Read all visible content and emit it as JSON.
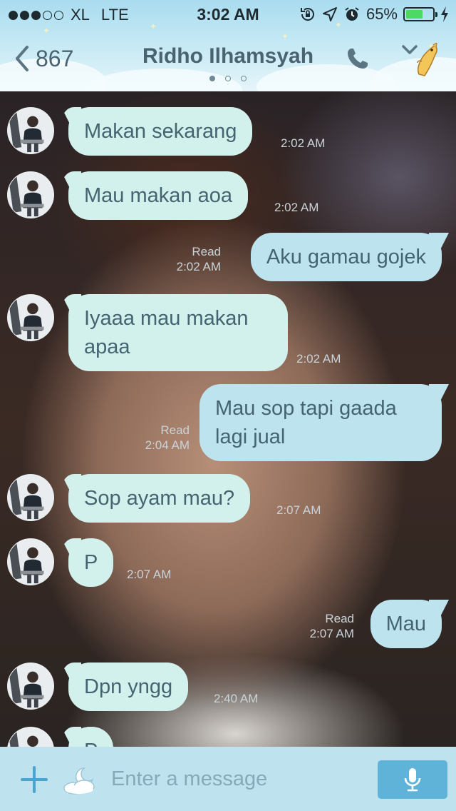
{
  "status_bar": {
    "carrier": "XL",
    "network": "LTE",
    "time": "3:02 AM",
    "battery": "65%",
    "battery_level": 0.65,
    "signal_bars_filled": 3,
    "signal_bars_total": 5
  },
  "nav": {
    "back_count": "867",
    "title": "Ridho Ilhamsyah",
    "page_count": 3,
    "active_page": 1
  },
  "messages": [
    {
      "direction": "in",
      "text": "Makan sekarang",
      "time": "2:02 AM"
    },
    {
      "direction": "in",
      "text": "Mau makan aoa",
      "time": "2:02 AM"
    },
    {
      "direction": "out",
      "text": "Aku gamau gojek",
      "status": "Read",
      "time": "2:02 AM"
    },
    {
      "direction": "in",
      "line1": "Iyaaa mau makan",
      "line2": "apaa",
      "time": "2:02 AM"
    },
    {
      "direction": "out",
      "line1": "Mau sop tapi gaada",
      "line2": "lagi jual",
      "status": "Read",
      "time": "2:04 AM"
    },
    {
      "direction": "in",
      "text": "Sop ayam mau?",
      "time": "2:07 AM"
    },
    {
      "direction": "in",
      "text": "P",
      "time": "2:07 AM"
    },
    {
      "direction": "out",
      "text": "Mau",
      "status": "Read",
      "time": "2:07 AM"
    },
    {
      "direction": "in",
      "text": "Dpn yngg",
      "time": "2:40 AM"
    },
    {
      "direction": "in",
      "text": "P",
      "time": ""
    }
  ],
  "input": {
    "placeholder": "Enter a message"
  },
  "icons": {
    "back": "chevron-left-icon",
    "call": "phone-icon",
    "dropdown": "chevron-down-icon",
    "sticker": "dog-sticker-icon",
    "attach": "plus-icon",
    "emoji": "cloud-moon-icon",
    "voice": "microphone-icon"
  },
  "colors": {
    "incoming_bubble": "#d3f1ec",
    "outgoing_bubble": "#bde3ef",
    "bubble_text": "#456471",
    "header_bg": "#c3e8f4",
    "input_bar_bg": "#bfe2ef",
    "mic_button": "#5fb3d8",
    "battery_fill": "#4cd964"
  }
}
